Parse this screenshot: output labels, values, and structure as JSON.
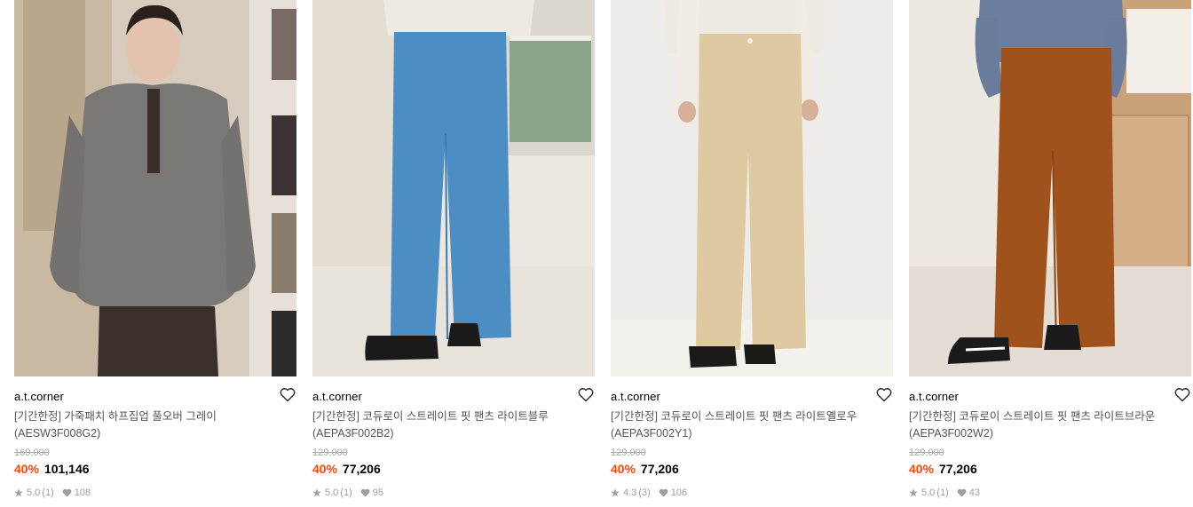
{
  "colors": {
    "discount": "#ff4800",
    "original_price": "#a8a8a8",
    "meta": "#a0a0a0"
  },
  "products": [
    {
      "brand": "a.t.corner",
      "name_line1": "[기간한정] 가죽패치 하프집업 풀오버 그레이",
      "name_line2": "(AESW3F008G2)",
      "original_price": "169,000",
      "discount": "40%",
      "price": "101,146",
      "rating": "5.0",
      "reviews": "(1)",
      "likes": "108",
      "image_icon": "gray-half-zip-sweater-photo"
    },
    {
      "brand": "a.t.corner",
      "name_line1": "[기간한정] 코듀로이 스트레이트 핏 팬츠 라이트블루",
      "name_line2": "(AEPA3F002B2)",
      "original_price": "129,000",
      "discount": "40%",
      "price": "77,206",
      "rating": "5.0",
      "reviews": "(1)",
      "likes": "95",
      "image_icon": "light-blue-corduroy-pants-photo"
    },
    {
      "brand": "a.t.corner",
      "name_line1": "[기간한정] 코듀로이 스트레이트 핏 팬츠 라이트옐로우",
      "name_line2": "(AEPA3F002Y1)",
      "original_price": "129,000",
      "discount": "40%",
      "price": "77,206",
      "rating": "4.3",
      "reviews": "(3)",
      "likes": "106",
      "image_icon": "light-yellow-corduroy-pants-photo"
    },
    {
      "brand": "a.t.corner",
      "name_line1": "[기간한정] 코듀로이 스트레이트 핏 팬츠 라이트브라운",
      "name_line2": "(AEPA3F002W2)",
      "original_price": "129,000",
      "discount": "40%",
      "price": "77,206",
      "rating": "5.0",
      "reviews": "(1)",
      "likes": "43",
      "image_icon": "light-brown-corduroy-pants-photo"
    }
  ]
}
